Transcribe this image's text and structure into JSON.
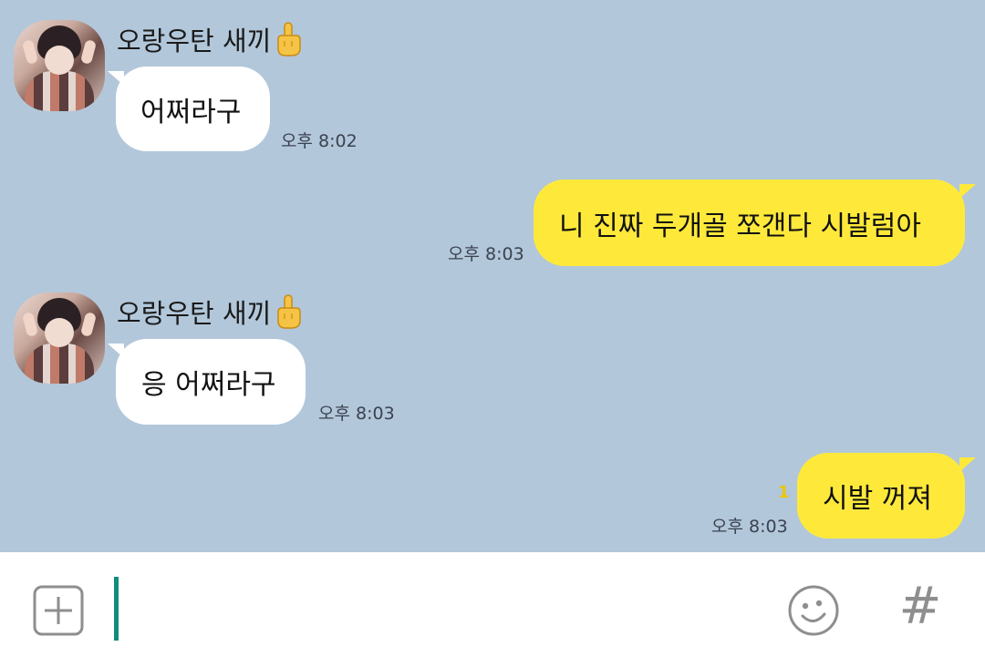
{
  "chat": {
    "background_color": "#b2c7da",
    "incoming_bubble_color": "#ffffff",
    "outgoing_bubble_color": "#fee93b",
    "messages": [
      {
        "direction": "in",
        "sender": "오랑우탄 새끼",
        "sender_emoji": "middle-finger-icon",
        "text": "어쩌라구",
        "time": "오후 8:02"
      },
      {
        "direction": "out",
        "text": "니 진짜 두개골 쪼갠다 시발럼아",
        "time": "오후 8:03"
      },
      {
        "direction": "in",
        "sender": "오랑우탄 새끼",
        "sender_emoji": "middle-finger-icon",
        "text": "응 어쩌라구",
        "time": "오후 8:03"
      },
      {
        "direction": "out",
        "text": "시발 꺼져",
        "time": "오후 8:03",
        "unread": "1"
      }
    ]
  },
  "input_bar": {
    "plus_icon": "plus-square-icon",
    "input_value": "",
    "emoji_icon": "smiley-icon",
    "hash_label": "#",
    "cursor_color": "#0f8c7c"
  }
}
